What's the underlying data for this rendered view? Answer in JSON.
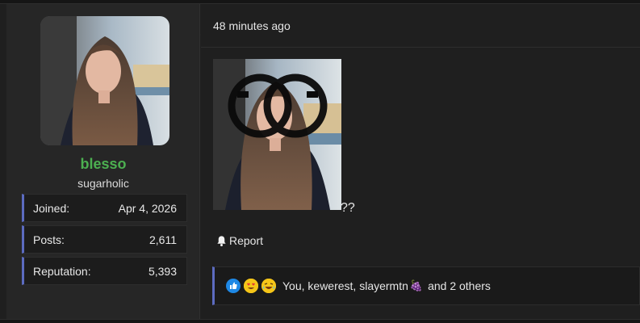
{
  "user": {
    "name": "blesso",
    "title": "sugarholic",
    "stats": [
      {
        "label": "Joined:",
        "value": "Apr 4, 2026"
      },
      {
        "label": "Posts:",
        "value": "2,611"
      },
      {
        "label": "Reputation:",
        "value": "5,393"
      }
    ]
  },
  "post": {
    "timestamp": "48 minutes ago",
    "body_text": "??",
    "report_label": "Report"
  },
  "reactions": {
    "icons": [
      "like-icon",
      "heart-eyes-icon",
      "laughing-icon"
    ],
    "names": "You, kewerest, slayermtn",
    "grape_emoji": "🍇",
    "others": "and 2 others"
  },
  "colors": {
    "username": "#4caf50",
    "accent_border": "#5c6bc0",
    "background": "#1f1f1f",
    "sidebar": "#262626"
  }
}
